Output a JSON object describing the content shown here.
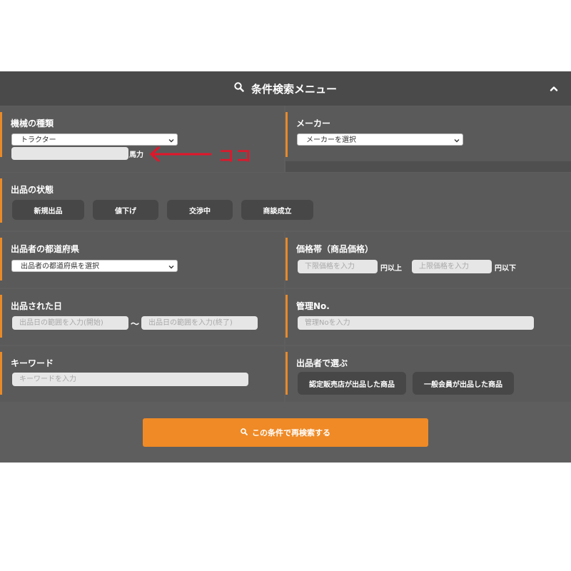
{
  "header": {
    "title": "条件検索メニュー",
    "search_icon": "search-icon",
    "collapse_icon": "chevron-up-icon"
  },
  "machine_type": {
    "label": "機械の種類",
    "selected": "トラクター",
    "horsepower_unit": "馬力",
    "horsepower_value": ""
  },
  "maker": {
    "label": "メーカー",
    "selected": "メーカーを選択"
  },
  "condition": {
    "label": "出品の状態",
    "options": [
      "新規出品",
      "値下げ",
      "交渉中",
      "商談成立"
    ]
  },
  "prefecture": {
    "label": "出品者の都道府県",
    "selected": "出品者の都道府県を選択"
  },
  "price": {
    "label": "価格帯（商品価格）",
    "min_placeholder": "下限価格を入力",
    "min_unit": "円以上",
    "max_placeholder": "上限価格を入力",
    "max_unit": "円以下"
  },
  "date": {
    "label": "出品された日",
    "start_placeholder": "出品日の範囲を入力(開始)",
    "separator": "〜",
    "end_placeholder": "出品日の範囲を入力(終了)"
  },
  "management_no": {
    "label": "管理No.",
    "placeholder": "管理Noを入力"
  },
  "keyword": {
    "label": "キーワード",
    "placeholder": "キーワードを入力"
  },
  "seller": {
    "label": "出品者で選ぶ",
    "options": [
      "認定販売店が出品した商品",
      "一般会員が出品した商品"
    ]
  },
  "search_button": {
    "label": "この条件で再検索する"
  },
  "annotation": {
    "text": "ココ",
    "color": "#e4152a"
  },
  "colors": {
    "accent": "#ef8a26",
    "panel": "#5e5e5e",
    "header": "#4a4a4a",
    "chip": "#474747"
  }
}
